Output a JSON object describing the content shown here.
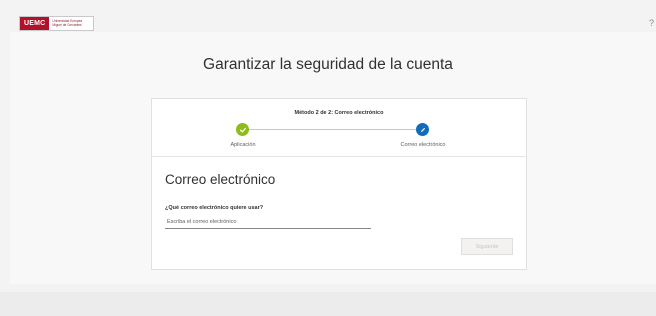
{
  "header": {
    "logo_mark": "UEMC",
    "logo_line1": "Universidad Europea",
    "logo_line2": "Miguel de Cervantes",
    "help_label": "?"
  },
  "page": {
    "title": "Garantizar la seguridad de la cuenta"
  },
  "wizard": {
    "step_header": "Método 2 de 2: Correo electrónico",
    "steps": [
      {
        "label": "Aplicación",
        "status": "completed",
        "color": "#8cbd18",
        "icon": "checkmark-icon"
      },
      {
        "label": "Correo electrónico",
        "status": "current",
        "color": "#0f6cbd",
        "icon": "pencil-icon"
      }
    ]
  },
  "form": {
    "section_title": "Correo electrónico",
    "question": "¿Qué correo electrónico quiere usar?",
    "email_placeholder": "Escriba el correo electrónico",
    "email_value": "",
    "next_label": "Siguiente",
    "next_disabled": true
  }
}
